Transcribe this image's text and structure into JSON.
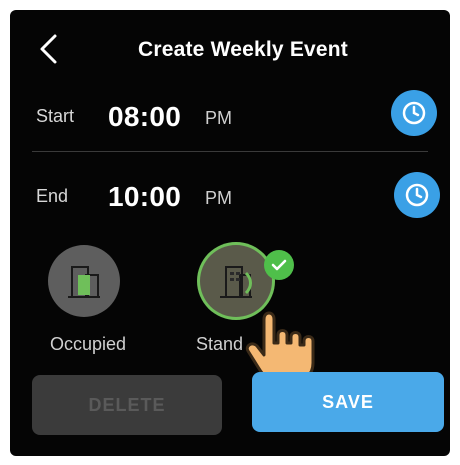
{
  "header": {
    "title": "Create Weekly Event"
  },
  "start": {
    "label": "Start",
    "time": "08:00",
    "ampm": "PM"
  },
  "end": {
    "label": "End",
    "time": "10:00",
    "ampm": "PM"
  },
  "modes": [
    {
      "label": "Occupied",
      "selected": false,
      "icon": "building-occupied-icon"
    },
    {
      "label": "Stand",
      "selected": true,
      "icon": "building-standby-icon"
    }
  ],
  "actions": {
    "delete_label": "DELETE",
    "save_label": "SAVE"
  },
  "colors": {
    "accent": "#3aa0e6",
    "save": "#4aa9e9",
    "check": "#4fbf4a",
    "building_green": "#6fbf5a",
    "disabled": "#3b3b3b"
  }
}
